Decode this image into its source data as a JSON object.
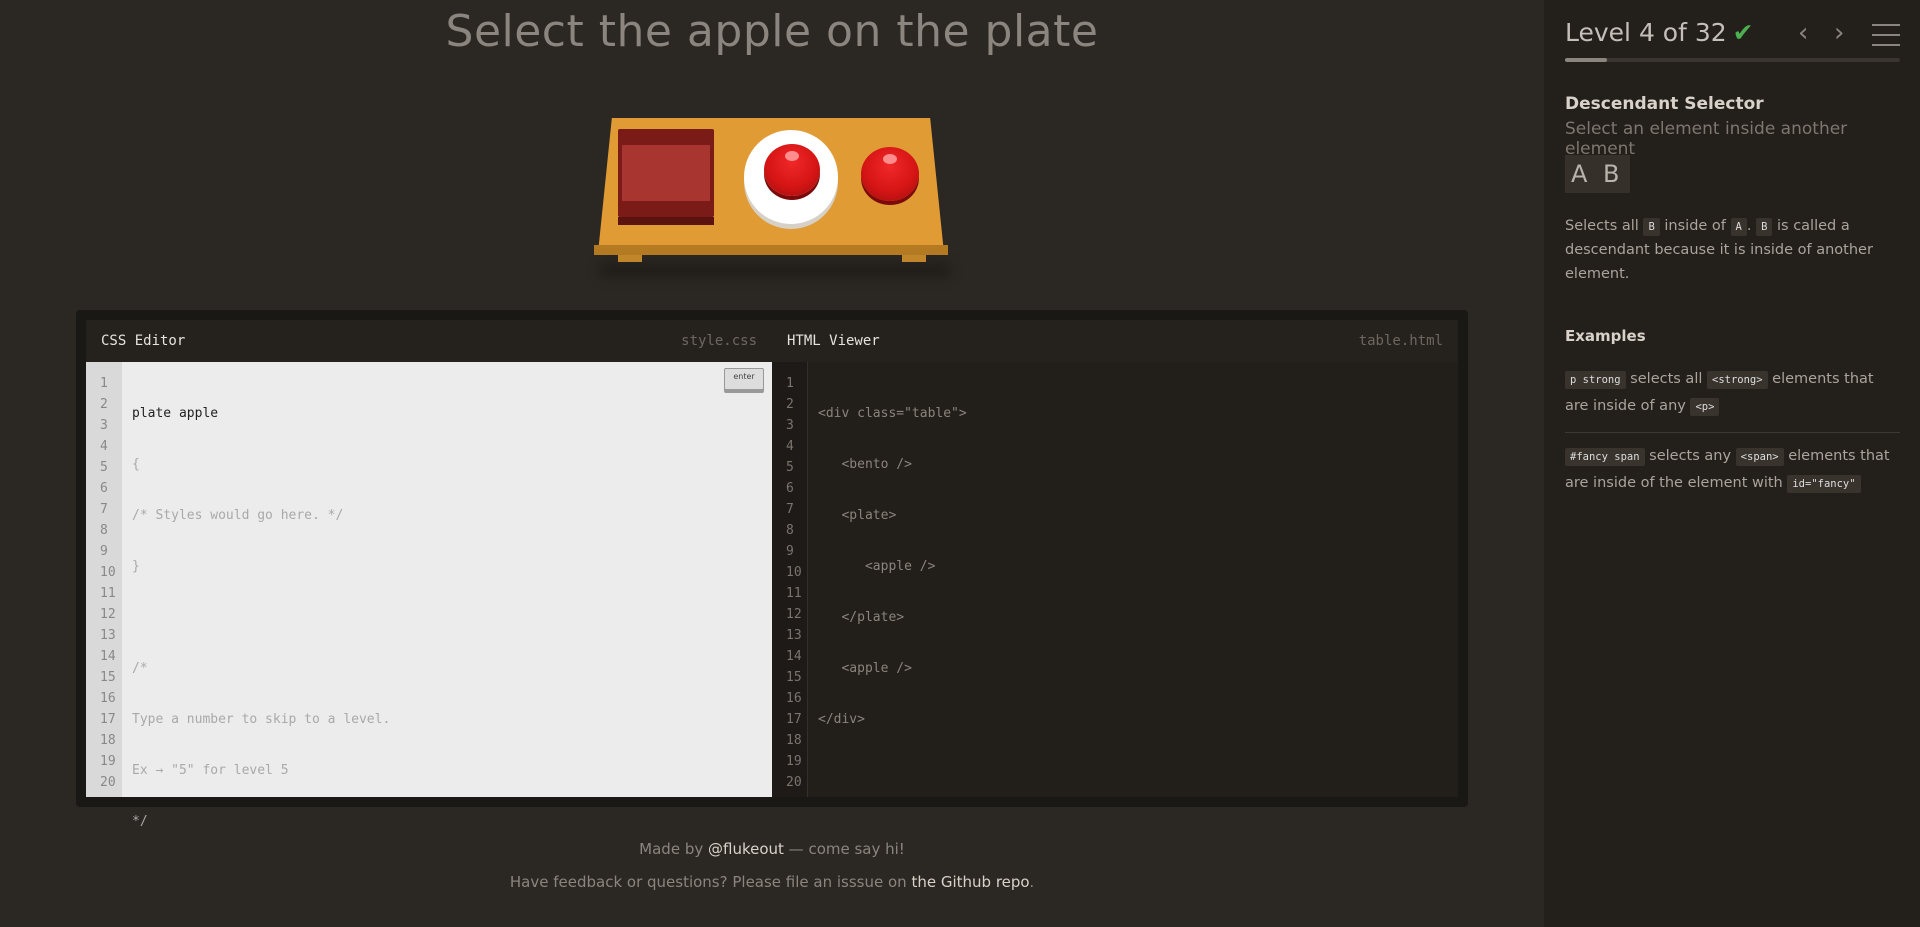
{
  "header": {
    "title": "Select the apple on the plate"
  },
  "css_editor": {
    "title": "CSS Editor",
    "filename": "style.css",
    "input_value": "plate apple",
    "enter_label": "enter",
    "lines": [
      "1",
      "2",
      "3",
      "4",
      "5",
      "6",
      "7",
      "8",
      "9",
      "10",
      "11",
      "12",
      "13",
      "14",
      "15",
      "16",
      "17",
      "18",
      "19",
      "20"
    ],
    "code": [
      "{",
      "/* Styles would go here. */",
      "}",
      "",
      "/*",
      "Type a number to skip to a level.",
      "Ex → \"5\" for level 5",
      "*/"
    ]
  },
  "html_viewer": {
    "title": "HTML Viewer",
    "filename": "table.html",
    "lines": [
      "1",
      "2",
      "3",
      "4",
      "5",
      "6",
      "7",
      "8",
      "9",
      "10",
      "11",
      "12",
      "13",
      "14",
      "15",
      "16",
      "17",
      "18",
      "19",
      "20"
    ],
    "code": [
      "<div class=\"table\">",
      "   <bento />",
      "   <plate>",
      "      <apple />",
      "   </plate>",
      "   <apple />",
      "</div>"
    ]
  },
  "footer": {
    "line1_prefix": "Made by ",
    "line1_link": "@flukeout",
    "line1_suffix": " — come say hi!",
    "line2_prefix": "Have feedback or questions? Please file an isssue on ",
    "line2_link": "the Github repo",
    "line2_suffix": "."
  },
  "sidebar": {
    "level_text": "Level 4 of 32",
    "check": "✔",
    "level_progress": 0.125,
    "prev": "‹",
    "next": "›",
    "selector_name": "Descendant Selector",
    "selector_title": "Select an element inside another element",
    "syntax": "A B",
    "desc": {
      "p1": "Selects all ",
      "t1": "B",
      "p2": " inside of ",
      "t2": "A",
      "p3": ". ",
      "t3": "B",
      "p4": " is called a descendant because it is inside of another element."
    },
    "examples_title": "Examples",
    "example1": {
      "code": "p  strong",
      "p1": " selects all ",
      "t1": "<strong>",
      "p2": " elements that are inside of any ",
      "t2": "<p>"
    },
    "example2": {
      "code": "#fancy  span",
      "p1": " selects any ",
      "t1": "<span>",
      "p2": " elements that are inside of the element with ",
      "t2": "id=\"fancy\""
    }
  },
  "colors": {
    "accent_check": "#4caf50",
    "apple": "#d61515",
    "table": "#e09b35"
  }
}
